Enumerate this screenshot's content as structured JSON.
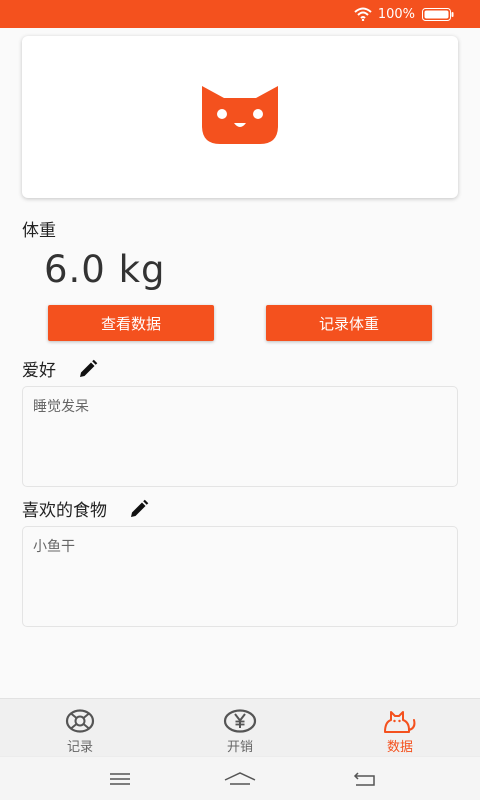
{
  "status_bar": {
    "battery_text": "100%"
  },
  "weight": {
    "label": "体重",
    "value": "6.0 kg"
  },
  "buttons": {
    "view_data": "查看数据",
    "record_weight": "记录体重"
  },
  "hobby": {
    "label": "爱好",
    "value": "睡觉发呆"
  },
  "food": {
    "label": "喜欢的食物",
    "value": "小鱼干"
  },
  "tabs": [
    {
      "label": "记录",
      "icon": "lifebuoy-icon",
      "active": false
    },
    {
      "label": "开销",
      "icon": "yen-icon",
      "active": false
    },
    {
      "label": "数据",
      "icon": "cat-icon",
      "active": true
    }
  ],
  "colors": {
    "accent": "#f4511e",
    "inactive": "#666666"
  },
  "navigation": {
    "icons": [
      "menu-icon",
      "home-icon",
      "back-icon"
    ]
  }
}
